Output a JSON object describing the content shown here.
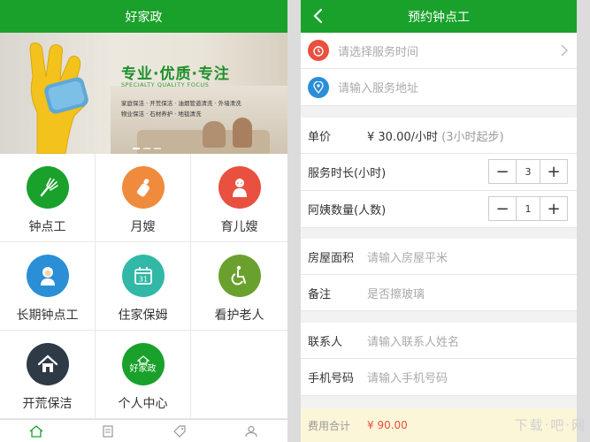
{
  "left": {
    "title": "好家政",
    "banner": {
      "headline": "专业·优质·专注",
      "subline": "SPECIALTY QUALITY FOCUS",
      "desc_line1": "家庭保洁 · 开荒保洁 · 油烟管道清洗 · 外墙清洗",
      "desc_line2": "物业保洁 · 石材养护 · 地毯清洗"
    },
    "services": [
      {
        "label": "钟点工",
        "color": "#1aa12b",
        "icon": "duster-icon"
      },
      {
        "label": "月嫂",
        "color": "#f08a3c",
        "icon": "baby-bottle-icon"
      },
      {
        "label": "育儿嫂",
        "color": "#e9503f",
        "icon": "baby-icon"
      },
      {
        "label": "长期钟点工",
        "color": "#2a8fd6",
        "icon": "nanny-icon"
      },
      {
        "label": "住家保姆",
        "color": "#32b8a6",
        "icon": "calendar-icon"
      },
      {
        "label": "看护老人",
        "color": "#6aa12e",
        "icon": "wheelchair-icon"
      },
      {
        "label": "开荒保洁",
        "color": "#2f3a47",
        "icon": "house-icon"
      },
      {
        "label": "个人中心",
        "color": "#1aa12b",
        "icon": "brand-logo-icon",
        "badge": "好家政"
      }
    ],
    "tabs": [
      "home-icon",
      "orders-icon",
      "tag-icon",
      "user-icon"
    ]
  },
  "right": {
    "title": "预约钟点工",
    "time_placeholder": "请选择服务时间",
    "address_placeholder": "请输入服务地址",
    "price_label": "单价",
    "price_value": "¥ 30.00/小时",
    "price_note": "(3小时起步)",
    "duration_label": "服务时长(小时)",
    "duration_value": "3",
    "aunt_label": "阿姨数量(人数)",
    "aunt_value": "1",
    "area_label": "房屋面积",
    "area_placeholder": "请输入房屋平米",
    "remark_label": "备注",
    "remark_placeholder": "是否擦玻璃",
    "contact_label": "联系人",
    "contact_placeholder": "请输入联系人姓名",
    "phone_label": "手机号码",
    "phone_placeholder": "请输入手机号码",
    "total_label": "费用合计",
    "total_value": "¥ 90.00",
    "watermark": "下载·吧·网"
  },
  "colors": {
    "brand": "#1aa12b",
    "accent_orange": "#f08a3c",
    "total_red": "#e9503f"
  }
}
